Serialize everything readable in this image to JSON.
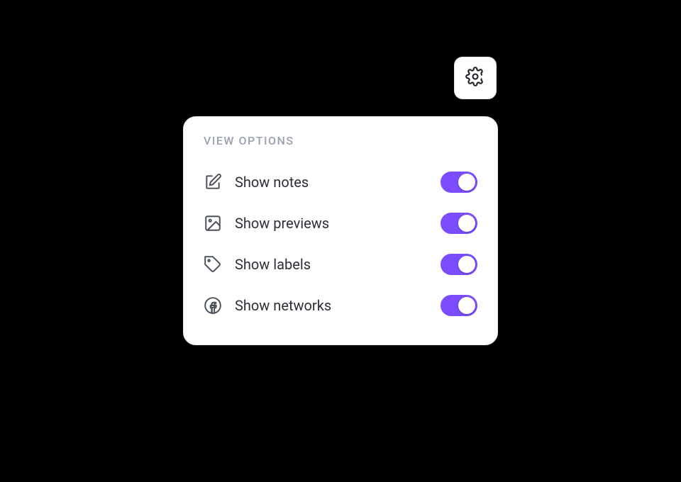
{
  "panel": {
    "title": "VIEW OPTIONS",
    "options": [
      {
        "key": "notes",
        "label": "Show notes",
        "icon": "note-icon",
        "on": true
      },
      {
        "key": "previews",
        "label": "Show previews",
        "icon": "image-icon",
        "on": true
      },
      {
        "key": "labels",
        "label": "Show labels",
        "icon": "tag-icon",
        "on": true
      },
      {
        "key": "networks",
        "label": "Show networks",
        "icon": "facebook-icon",
        "on": true
      }
    ]
  },
  "colors": {
    "accent": "#7c4dff"
  }
}
